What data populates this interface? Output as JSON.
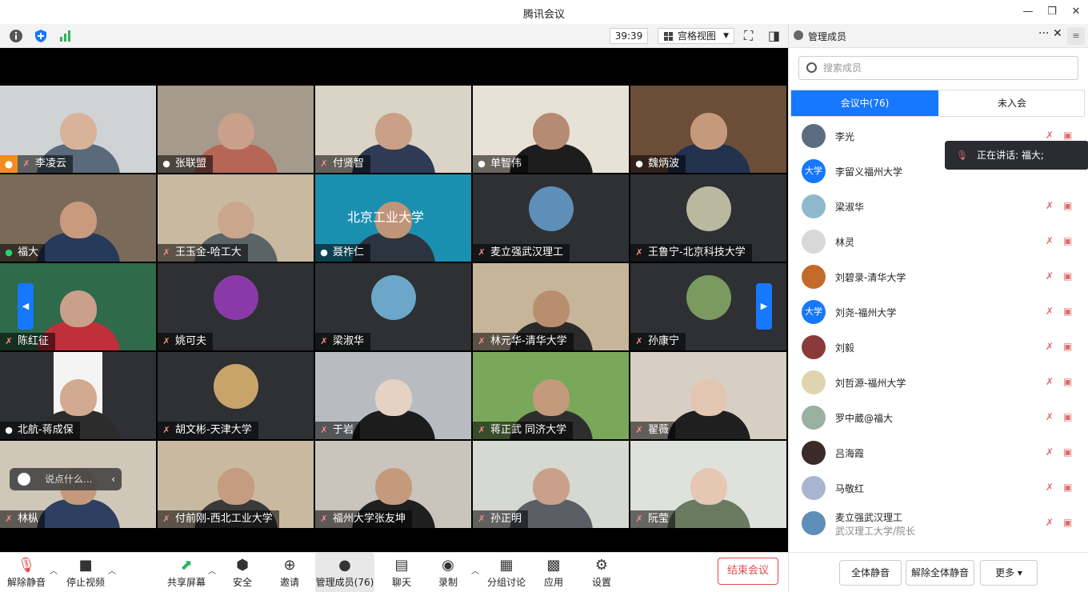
{
  "window": {
    "title": "腾讯会议",
    "min": "—",
    "restore": "❐",
    "close": "✕"
  },
  "toolbar": {
    "timer": "39:39",
    "view": "宫格视图",
    "fullscreen": "⛶",
    "sidebar": "◨"
  },
  "tiles": [
    {
      "name": "李凌云",
      "bg": "#cfd3d6",
      "face": "#d8b39a",
      "shirt": "#5a6a7a",
      "host": true,
      "muted": true
    },
    {
      "name": "张联盟",
      "bg": "#a59a8c",
      "face": "#c9a08a",
      "shirt": "#b56657",
      "muted": false
    },
    {
      "name": "付贤智",
      "bg": "#d9d4c6",
      "face": "#caa086",
      "shirt": "#2f3b54",
      "muted": true
    },
    {
      "name": "单智伟",
      "bg": "#e8e2d6",
      "face": "#b58c72",
      "shirt": "#1d1d1d",
      "muted": false
    },
    {
      "name": "魏炳波",
      "bg": "#6b4d38",
      "face": "#c59a7c",
      "shirt": "#22324e",
      "muted": false
    },
    {
      "name": "福大",
      "bg": "#7a6a5a",
      "face": "#c99a7e",
      "shirt": "#263a5c",
      "muted": false,
      "active": true
    },
    {
      "name": "王玉金-哈工大",
      "bg": "#c9b9a0",
      "face": "#caa68c",
      "shirt": "#5a6466",
      "muted": true
    },
    {
      "name": "聂祚仁",
      "bg": "#1b8fb0",
      "face": "#c09478",
      "shirt": "#2c3440",
      "muted": false,
      "logo": "北京工业大学"
    },
    {
      "name": "麦立强武汉理工",
      "bg": "#2e3034",
      "avatar": "#5d8fb8",
      "muted": true
    },
    {
      "name": "王鲁宁-北京科技大学",
      "bg": "#2e3034",
      "avatar": "#b9b9a0",
      "muted": true
    },
    {
      "name": "陈红征",
      "bg": "#2f6a4a",
      "face": "#caa08a",
      "shirt": "#c0303a",
      "muted": true
    },
    {
      "name": "姚可夫",
      "bg": "#2e3034",
      "avatar": "#8a3aa8",
      "muted": true
    },
    {
      "name": "梁淑华",
      "bg": "#2e3034",
      "avatar": "#6aa7c8",
      "muted": true
    },
    {
      "name": "林元华-清华大学",
      "bg": "#c7b59a",
      "face": "#b88e6e",
      "shirt": "#2a2a2a",
      "muted": true
    },
    {
      "name": "孙康宁",
      "bg": "#2e3034",
      "avatar": "#7a9a60",
      "muted": true
    },
    {
      "name": "北航-蒋成保",
      "bg": "#2e3034",
      "face": "#d2aa90",
      "shirt": "#2c2c2c",
      "muted": false,
      "portrait": true
    },
    {
      "name": "胡文彬-天津大学",
      "bg": "#2e3034",
      "avatar": "#c8a46a",
      "muted": true
    },
    {
      "name": "于岩",
      "bg": "#b8bcc0",
      "face": "#e6d2c4",
      "shirt": "#1c1c1c",
      "muted": true
    },
    {
      "name": "蒋正武 同济大学",
      "bg": "#7aa85a",
      "face": "#c49a7c",
      "shirt": "#2e2e2e",
      "muted": true
    },
    {
      "name": "翟薇",
      "bg": "#d8cfc4",
      "face": "#e2c6b2",
      "shirt": "#1f1f1f",
      "muted": true
    },
    {
      "name": "林枞",
      "bg": "#cfc7b8",
      "face": "#c59a7c",
      "shirt": "#2f3f62",
      "muted": true
    },
    {
      "name": "付前刚-西北工业大学",
      "bg": "#c9b9a0",
      "face": "#c49c80",
      "shirt": "#3a3a3a",
      "muted": true
    },
    {
      "name": "福州大学张友坤",
      "bg": "#c9c4bc",
      "face": "#c59a7c",
      "shirt": "#1f1f1f",
      "muted": true
    },
    {
      "name": "孙正明",
      "bg": "#d6d8d2",
      "face": "#caa08a",
      "shirt": "#5a5f66",
      "muted": true
    },
    {
      "name": "阮莹",
      "bg": "#dfe2dc",
      "face": "#e6c8b2",
      "shirt": "#6a7a60",
      "muted": true
    }
  ],
  "chat": {
    "placeholder": "说点什么...",
    "back": "‹"
  },
  "nav": {
    "prev": "◀",
    "next": "▶"
  },
  "bottom": {
    "unmute": "解除静音",
    "stop_video": "停止视频",
    "share": "共享屏幕",
    "security": "安全",
    "invite": "邀请",
    "manage": "管理成员(76)",
    "chat": "聊天",
    "record": "录制",
    "breakout": "分组讨论",
    "apps": "应用",
    "settings": "设置",
    "end": "结束会议"
  },
  "panel": {
    "title": "管理成员",
    "more": "···",
    "close": "✕",
    "side": "≡",
    "search_placeholder": "搜索成员",
    "tab_in": "会议中(76)",
    "tab_out": "未入会",
    "speaking": "正在讲话: 福大;",
    "members": [
      {
        "name": "李光",
        "color": "#5c6c80"
      },
      {
        "name": "李留义福州大学",
        "color": "#1677ff",
        "text": "大学"
      },
      {
        "name": "梁淑华",
        "color": "#8fb8cc"
      },
      {
        "name": "林灵",
        "color": "#d8d8d8"
      },
      {
        "name": "刘碧录-清华大学",
        "color": "#c46a2a"
      },
      {
        "name": "刘尧-福州大学",
        "color": "#1677ff",
        "text": "大学"
      },
      {
        "name": "刘毅",
        "color": "#8a3a3a"
      },
      {
        "name": "刘哲源-福州大学",
        "color": "#e0d4b0"
      },
      {
        "name": "罗中葳@福大",
        "color": "#9ab0a0"
      },
      {
        "name": "吕海霞",
        "color": "#3a2a2a"
      },
      {
        "name": "马敬红",
        "color": "#a8b4d0"
      },
      {
        "name": "麦立强武汉理工",
        "color": "#5d8fb8",
        "sub": "武汉理工大学/院长"
      }
    ],
    "mute_all": "全体静音",
    "unmute_all": "解除全体静音",
    "more_btn": "更多 ▾"
  }
}
